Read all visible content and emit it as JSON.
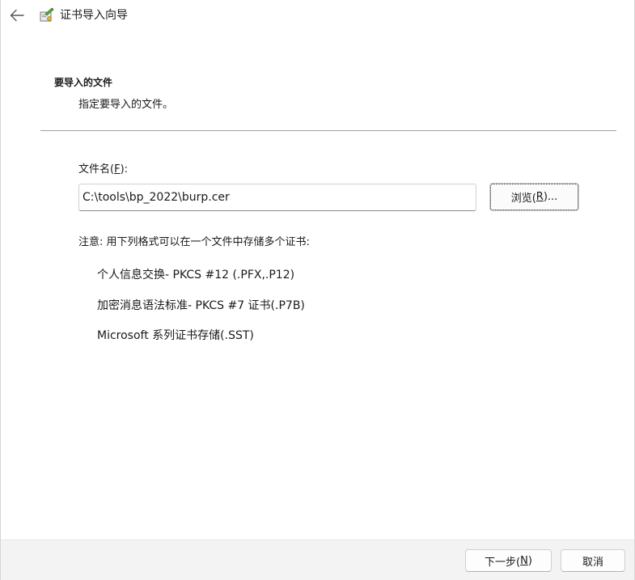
{
  "window": {
    "title": "证书导入向导",
    "icons": {
      "back": "back-arrow-icon",
      "app": "certificate-wizard-icon"
    }
  },
  "section": {
    "heading": "要导入的文件",
    "subtitle": "指定要导入的文件。"
  },
  "file": {
    "label_prefix": "文件名(",
    "label_accel": "F",
    "label_suffix": "):",
    "value": "C:\\tools\\bp_2022\\burp.cer",
    "browse_prefix": "浏览(",
    "browse_accel": "R",
    "browse_suffix": ")..."
  },
  "note": "注意: 用下列格式可以在一个文件中存储多个证书:",
  "formats": [
    "个人信息交换- PKCS #12 (.PFX,.P12)",
    "加密消息语法标准- PKCS #7 证书(.P7B)",
    "Microsoft 系列证书存储(.SST)"
  ],
  "footer": {
    "next_prefix": "下一步(",
    "next_accel": "N",
    "next_suffix": ")",
    "cancel": "取消"
  }
}
